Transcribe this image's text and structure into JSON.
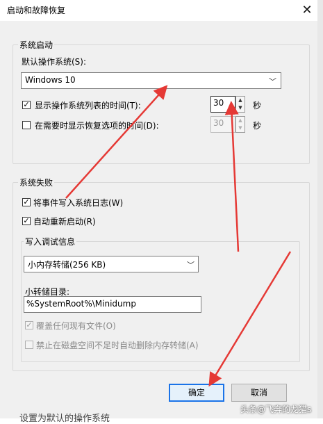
{
  "dialog": {
    "title": "启动和故障恢复",
    "close_glyph": "✕"
  },
  "system_startup": {
    "group_label": "系统启动",
    "default_os_label": "默认操作系统(S):",
    "default_os_value": "Windows 10",
    "show_os_list": {
      "checked": true,
      "label": "显示操作系统列表的时间(T):",
      "value": "30"
    },
    "show_recovery": {
      "checked": false,
      "label": "在需要时显示恢复选项的时间(D):",
      "value": "30"
    },
    "seconds_unit": "秒"
  },
  "system_failure": {
    "group_label": "系统失败",
    "write_event_log": {
      "checked": true,
      "label": "将事件写入系统日志(W)"
    },
    "auto_restart": {
      "checked": true,
      "label": "自动重新启动(R)"
    },
    "debug_info": {
      "group_label": "写入调试信息",
      "dump_type": "小内存转储(256 KB)",
      "dump_dir_label": "小转储目录:",
      "dump_dir_value": "%SystemRoot%\\Minidump",
      "overwrite": {
        "checked": true,
        "disabled": true,
        "label": "覆盖任何现有文件(O)"
      },
      "disable_auto_delete": {
        "checked": false,
        "disabled": true,
        "label": "禁止在磁盘空间不足时自动删除内存转储(A)"
      }
    }
  },
  "buttons": {
    "ok": "确定",
    "cancel": "取消"
  },
  "watermark": "头条@飞奔的龙猫s",
  "bottom_text": "设置为默认的操作系统",
  "icons": {
    "check": "✓",
    "up": "▲",
    "down": "▼",
    "chevron": "﹀"
  },
  "colors": {
    "annotation_arrow": "#e53935",
    "ok_border": "#1a73e8"
  }
}
